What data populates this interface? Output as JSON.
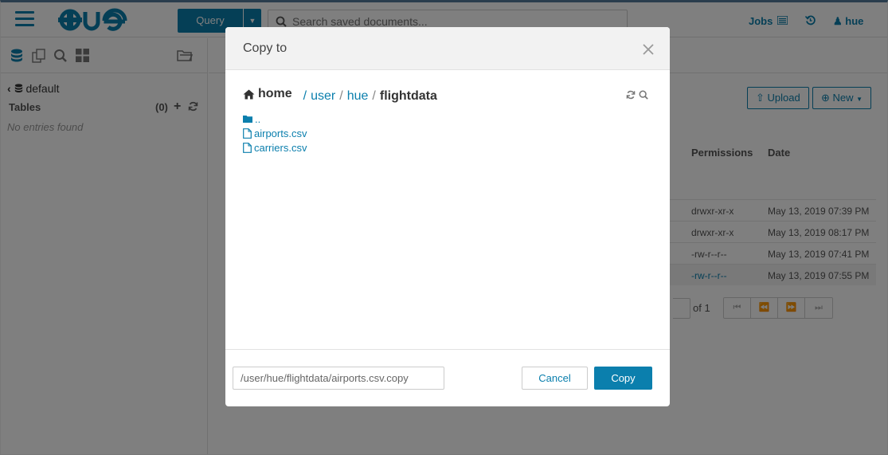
{
  "colors": {
    "accent": "#0b7fad",
    "topborder": "#2a3d4d"
  },
  "topbar": {
    "logo_text": "HUE",
    "query_label": "Query",
    "search_placeholder": "Search saved documents...",
    "jobs_label": "Jobs",
    "user_label": "hue"
  },
  "sidebar": {
    "database": "default",
    "tables_label": "Tables",
    "tables_count": "(0)",
    "empty_text": "No entries found",
    "tool_icons": [
      "database-icon",
      "copy-documents-icon",
      "search-zoom-icon",
      "grid-apps-icon",
      "folder-open-icon"
    ]
  },
  "main": {
    "upload_label": "Upload",
    "new_label": "New",
    "columns": {
      "permissions": "Permissions",
      "date": "Date"
    },
    "rows": [
      {
        "permissions": "drwxr-xr-x",
        "date": "May 13, 2019 07:39 PM"
      },
      {
        "permissions": "drwxr-xr-x",
        "date": "May 13, 2019 08:17 PM"
      },
      {
        "permissions": "-rw-r--r--",
        "date": "May 13, 2019 07:41 PM"
      },
      {
        "permissions": "-rw-r--r--",
        "date": "May 13, 2019 07:55 PM"
      }
    ],
    "pager_of": "of 1"
  },
  "modal": {
    "title": "Copy to",
    "breadcrumb": {
      "home": "home",
      "parts": [
        "user",
        "hue"
      ],
      "current": "flightdata"
    },
    "files": [
      {
        "name": "..",
        "type": "folder"
      },
      {
        "name": "airports.csv",
        "type": "file"
      },
      {
        "name": "carriers.csv",
        "type": "file"
      }
    ],
    "path_value": "/user/hue/flightdata/airports.csv.copy",
    "cancel_label": "Cancel",
    "copy_label": "Copy"
  }
}
